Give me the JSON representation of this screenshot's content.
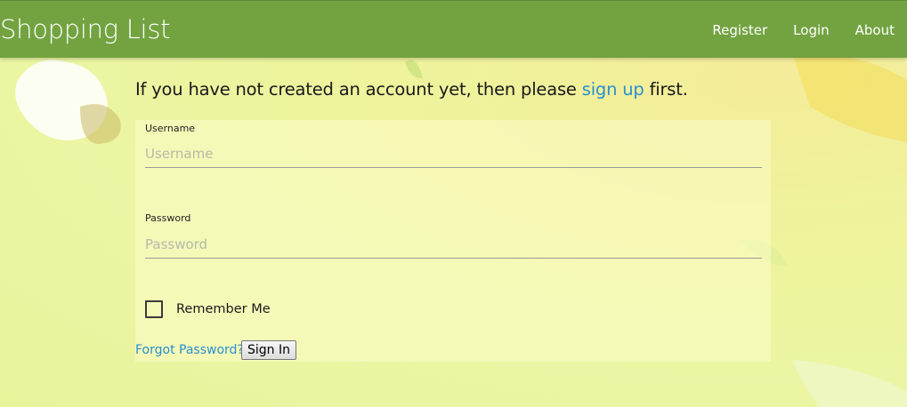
{
  "navbar": {
    "brand": "Shopping List",
    "links": [
      {
        "label": "Register"
      },
      {
        "label": "Login"
      },
      {
        "label": "About"
      }
    ],
    "color": "#72a340"
  },
  "intro": {
    "prefix": "If you have not created an account yet, then please ",
    "link": "sign up",
    "suffix": " first."
  },
  "form": {
    "username": {
      "label": "Username",
      "placeholder": "Username",
      "value": ""
    },
    "password": {
      "label": "Password",
      "placeholder": "Password",
      "value": ""
    },
    "remember_me": {
      "label": "Remember Me",
      "checked": false
    },
    "forgot_password": "Forgot Password?",
    "sign_in": "Sign In"
  },
  "colors": {
    "link": "#2a8fd0",
    "background": "#ecf5a3"
  }
}
